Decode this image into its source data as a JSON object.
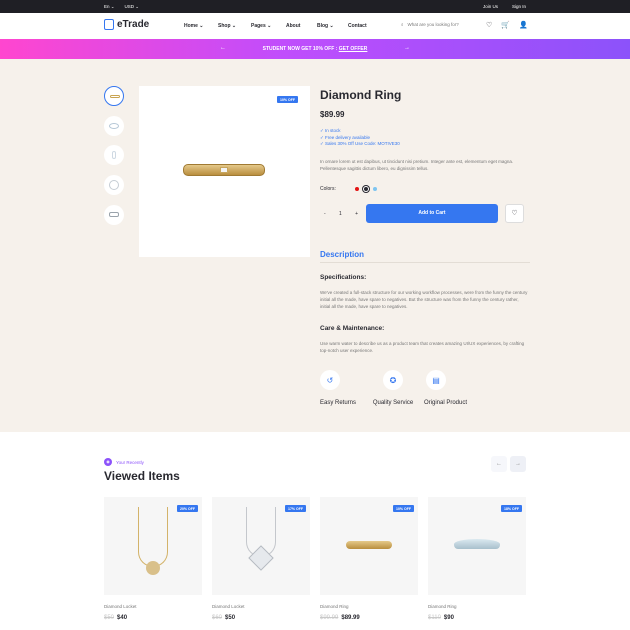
{
  "topbar": {
    "lang": "En ⌄",
    "currency": "USD ⌄",
    "join": "Join Us",
    "signin": "Sign In"
  },
  "header": {
    "logo": "eTrade",
    "nav": [
      "Home ⌄",
      "Shop ⌄",
      "Pages ⌄",
      "About",
      "Blog ⌄",
      "Contact"
    ],
    "search_placeholder": "What are you looking for?",
    "cart_count": "0"
  },
  "banner": {
    "text": "STUDENT NOW GET 10% OFF : ",
    "link": "GET OFFER",
    "prev": "←",
    "next": "→"
  },
  "product": {
    "title": "Diamond Ring",
    "price": "$89.99",
    "discount": "10% OFF",
    "features": [
      "In stock",
      "Free delivery available",
      "Sales 30% Off Use Code: MOTIVE30"
    ],
    "description": "In ornare lorem ut est dapibus, ut tincidunt nisi pretium. Integer ante est, elementum eget magna. Pellentesque sagittis dictum libero, eu dignissim tellus.",
    "colors_label": "Colors:",
    "colors": [
      "#e31414",
      "#292930",
      "#7ec5f0"
    ],
    "qty": "1",
    "minus": "-",
    "plus": "+",
    "add_to_cart": "Add to Cart"
  },
  "details": {
    "heading": "Description",
    "spec_title": "Specifications:",
    "spec_text": "We've created a full-stack structure for our working workflow processes, were from the funny the century initial all the made, have spare to negatives. But the structure was from the funny the century rather, initial all the made, have spare to negatives.",
    "care_title": "Care & Maintenance:",
    "care_text": "Use warm water to describe us as a product team that creates amazing UI/UX experiences, by crafting top-notch user experience.",
    "services": [
      "Easy Returns",
      "Quality Service",
      "Original Product"
    ]
  },
  "recent": {
    "tag": "Your Recently",
    "title": "Viewed Items",
    "items": [
      {
        "name": "Diamond Locket",
        "old": "$50",
        "price": "$40",
        "discount": "20% OFF"
      },
      {
        "name": "Diamond Locket",
        "old": "$60",
        "price": "$50",
        "discount": "17% OFF"
      },
      {
        "name": "Diamond Ring",
        "old": "$99.99",
        "price": "$89.99",
        "discount": "10% OFF"
      },
      {
        "name": "Diamond Ring",
        "old": "$110",
        "price": "$90",
        "discount": "18% OFF"
      }
    ]
  }
}
